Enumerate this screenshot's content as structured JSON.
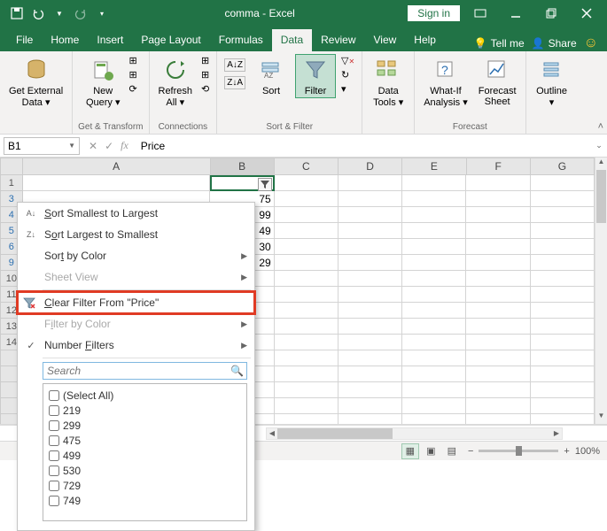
{
  "title": "comma - Excel",
  "signin": "Sign in",
  "tabs": [
    "File",
    "Home",
    "Insert",
    "Page Layout",
    "Formulas",
    "Data",
    "Review",
    "View",
    "Help"
  ],
  "tellme": "Tell me",
  "share": "Share",
  "ribbon": {
    "get_external": "Get External\nData ▾",
    "new_query": "New\nQuery ▾",
    "show_queries": "⊞",
    "from_table": "⊞",
    "recent": "⟳",
    "group_get": "Get & Transform",
    "refresh": "Refresh\nAll ▾",
    "conn1": "⊞",
    "conn2": "⊞",
    "conn3": "⟲",
    "group_conn": "Connections",
    "sort_az": "A↓Z",
    "sort_za": "Z↓A",
    "sort": "Sort",
    "filter": "Filter",
    "clear": "✕",
    "reapply": "↻",
    "adv": "▾",
    "group_sort": "Sort & Filter",
    "data_tools": "Data\nTools ▾",
    "whatif": "What-If\nAnalysis ▾",
    "forecast": "Forecast\nSheet",
    "group_forecast": "Forecast",
    "outline": "Outline\n▾"
  },
  "namebox": "B1",
  "formula": "Price",
  "columns": [
    "A",
    "B",
    "C",
    "D",
    "E",
    "F",
    "G"
  ],
  "visible_rows": [
    "1",
    "3",
    "4",
    "5",
    "6",
    "9",
    "10",
    "11",
    "12",
    "13",
    "14"
  ],
  "b_values": {
    "3": "75",
    "4": "99",
    "5": "49",
    "6": "30",
    "9": "29"
  },
  "filter_applied": true,
  "context_menu": {
    "sort_s2l": "Sort Smallest to Largest",
    "sort_l2s": "Sort Largest to Smallest",
    "sort_color": "Sort by Color",
    "sheet_view": "Sheet View",
    "clear_filter": "Clear Filter From \"Price\"",
    "filter_color": "Filter by Color",
    "number_filters": "Number Filters",
    "search_placeholder": "Search",
    "items": [
      "(Select All)",
      "219",
      "299",
      "475",
      "499",
      "530",
      "729",
      "749"
    ]
  },
  "status": {
    "zoom": "100%"
  }
}
